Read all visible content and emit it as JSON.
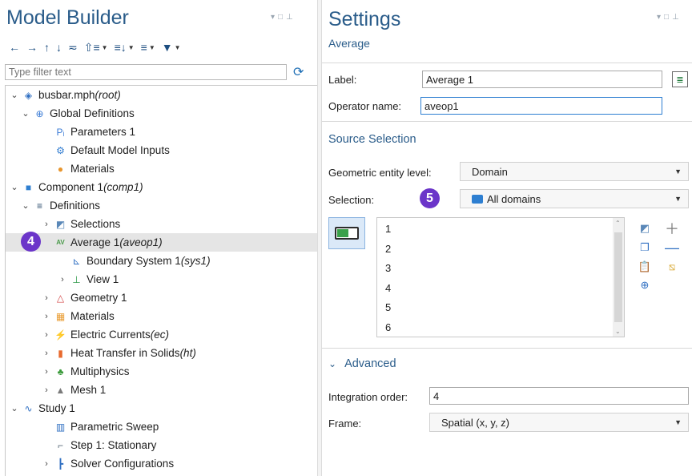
{
  "left": {
    "title": "Model Builder",
    "filter_placeholder": "Type filter text",
    "tree": [
      {
        "toggle": "⌄",
        "icon": "◈",
        "label": "busbar.mph",
        "suffix": "(root)",
        "icon_name": "model-root-icon",
        "color": "#2f6fc2"
      },
      {
        "toggle": "⌄",
        "icon": "⊕",
        "label": "Global Definitions",
        "suffix": "",
        "icon_name": "globe-icon",
        "color": "#3a7bd5"
      },
      {
        "toggle": "",
        "icon": "Pᵢ",
        "label": "Parameters 1",
        "suffix": "",
        "icon_name": "parameters-icon",
        "color": "#3a7bd5"
      },
      {
        "toggle": "",
        "icon": "⚙",
        "label": "Default Model Inputs",
        "suffix": "",
        "icon_name": "model-inputs-icon",
        "color": "#2f7bd0"
      },
      {
        "toggle": "",
        "icon": "●",
        "label": "Materials",
        "suffix": "",
        "icon_name": "materials-icon",
        "color": "#e8962e"
      },
      {
        "toggle": "⌄",
        "icon": "■",
        "label": "Component 1",
        "suffix": "(comp1)",
        "icon_name": "component-icon",
        "color": "#2f7fd0"
      },
      {
        "toggle": "⌄",
        "icon": "≡",
        "label": "Definitions",
        "suffix": "",
        "icon_name": "definitions-icon",
        "color": "#2d4e6e"
      },
      {
        "toggle": "›",
        "icon": "◩",
        "label": "Selections",
        "suffix": "",
        "icon_name": "selections-icon",
        "color": "#5a88b8"
      },
      {
        "toggle": "",
        "icon": "AV",
        "label": "Average 1",
        "suffix": "(aveop1)",
        "icon_name": "average-operator-icon",
        "color": "#4a9a4a"
      },
      {
        "toggle": "",
        "icon": "⊾",
        "label": "Boundary System 1",
        "suffix": "(sys1)",
        "icon_name": "boundary-system-icon",
        "color": "#2f6fc2"
      },
      {
        "toggle": "›",
        "icon": "⊥",
        "label": "View 1",
        "suffix": "",
        "icon_name": "view-icon",
        "color": "#2f9a4a"
      },
      {
        "toggle": "›",
        "icon": "△",
        "label": "Geometry 1",
        "suffix": "",
        "icon_name": "geometry-icon",
        "color": "#d44a4a"
      },
      {
        "toggle": "›",
        "icon": "▦",
        "label": "Materials",
        "suffix": "",
        "icon_name": "materials-grid-icon",
        "color": "#e89a2e"
      },
      {
        "toggle": "›",
        "icon": "⚡",
        "label": "Electric Currents",
        "suffix": "(ec)",
        "icon_name": "electric-currents-icon",
        "color": "#2f6fc2"
      },
      {
        "toggle": "›",
        "icon": "▮",
        "label": "Heat Transfer in Solids",
        "suffix": "(ht)",
        "icon_name": "heat-transfer-icon",
        "color": "#e86a2e"
      },
      {
        "toggle": "›",
        "icon": "♣",
        "label": "Multiphysics",
        "suffix": "",
        "icon_name": "multiphysics-icon",
        "color": "#3a9a3a"
      },
      {
        "toggle": "›",
        "icon": "▲",
        "label": "Mesh 1",
        "suffix": "",
        "icon_name": "mesh-icon",
        "color": "#7a7a7a"
      },
      {
        "toggle": "⌄",
        "icon": "∿",
        "label": "Study 1",
        "suffix": "",
        "icon_name": "study-icon",
        "color": "#2f6fc2"
      },
      {
        "toggle": "",
        "icon": "▥",
        "label": "Parametric Sweep",
        "suffix": "",
        "icon_name": "parametric-sweep-icon",
        "color": "#2f6fc2"
      },
      {
        "toggle": "",
        "icon": "⌐",
        "label": "Step 1: Stationary",
        "suffix": "",
        "icon_name": "stationary-step-icon",
        "color": "#5a6a7a"
      },
      {
        "toggle": "›",
        "icon": "┣",
        "label": "Solver Configurations",
        "suffix": "",
        "icon_name": "solver-configurations-icon",
        "color": "#2f6fc2"
      }
    ],
    "badge_label": "4"
  },
  "right": {
    "title": "Settings",
    "subtitle": "Average",
    "label_label": "Label:",
    "label_value": "Average 1",
    "opname_label": "Operator name:",
    "opname_value": "aveop1",
    "source_heading": "Source Selection",
    "entity_label": "Geometric entity level:",
    "entity_value": "Domain",
    "selection_label": "Selection:",
    "selection_value": "All domains",
    "badge_label": "5",
    "list_items": [
      "1",
      "2",
      "3",
      "4",
      "5",
      "6"
    ],
    "advanced_heading": "Advanced",
    "advanced_toggle": "⌄",
    "integration_label": "Integration order:",
    "integration_value": "4",
    "frame_label": "Frame:",
    "frame_value": "Spatial  (x, y, z)"
  },
  "colors": {
    "accent": "#2a5c8a",
    "badge": "#6b35c9",
    "selected_row": "#e5e5e5"
  }
}
